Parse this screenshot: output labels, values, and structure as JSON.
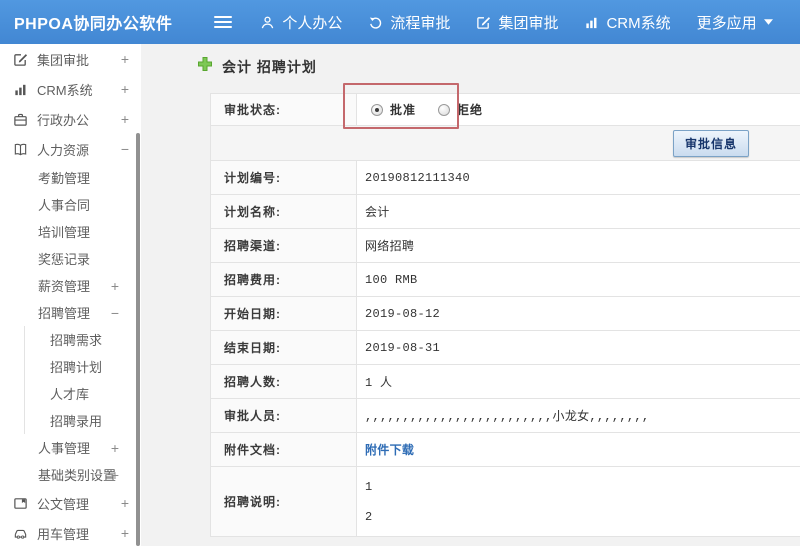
{
  "colors": {
    "header_blue": "#4a90dc",
    "annotation_red": "#c4686c",
    "link_blue": "#2e6cb5",
    "plus_green": "#76c043"
  },
  "header": {
    "brand": "PHPOA协同办公软件",
    "nav": [
      {
        "name": "personal-office",
        "label": "个人办公",
        "icon": "person-icon"
      },
      {
        "name": "workflow-approval",
        "label": "流程审批",
        "icon": "cycle-icon"
      },
      {
        "name": "group-approval",
        "label": "集团审批",
        "icon": "edit-square-icon"
      },
      {
        "name": "crm-system",
        "label": "CRM系统",
        "icon": "bar-chart-icon"
      },
      {
        "name": "more-apps",
        "label": "更多应用",
        "caret": true
      }
    ]
  },
  "sidebar": {
    "items": [
      {
        "name": "group-approval",
        "label": "集团审批",
        "icon": "edit-square-icon",
        "expander": "+",
        "level": 0
      },
      {
        "name": "crm-system",
        "label": "CRM系统",
        "icon": "bar-chart-icon",
        "expander": "+",
        "level": 0
      },
      {
        "name": "admin-office",
        "label": "行政办公",
        "icon": "briefcase-icon",
        "expander": "+",
        "level": 0
      },
      {
        "name": "human-resources",
        "label": "人力资源",
        "icon": "book-icon",
        "expander": "−",
        "level": 0
      },
      {
        "name": "attendance-mgmt",
        "label": "考勤管理",
        "level": 1
      },
      {
        "name": "personnel-contract",
        "label": "人事合同",
        "level": 1
      },
      {
        "name": "training-mgmt",
        "label": "培训管理",
        "level": 1
      },
      {
        "name": "reward-punishment",
        "label": "奖惩记录",
        "level": 1
      },
      {
        "name": "salary-mgmt",
        "label": "薪资管理",
        "expander": "+",
        "level": 1
      },
      {
        "name": "recruitment-mgmt",
        "label": "招聘管理",
        "expander": "−",
        "level": 1
      },
      {
        "name": "recruitment-needs",
        "label": "招聘需求",
        "level": 2
      },
      {
        "name": "recruitment-plan",
        "label": "招聘计划",
        "level": 2
      },
      {
        "name": "talent-pool",
        "label": "人才库",
        "level": 2
      },
      {
        "name": "recruitment-hiring",
        "label": "招聘录用",
        "level": 2
      },
      {
        "name": "personnel-mgmt",
        "label": "人事管理",
        "expander": "+",
        "level": 1
      },
      {
        "name": "basic-category-settings",
        "label": "基础类别设置",
        "expander": "+",
        "level": 1
      },
      {
        "name": "document-mgmt",
        "label": "公文管理",
        "icon": "document-icon",
        "expander": "+",
        "level": 0
      },
      {
        "name": "vehicle-mgmt",
        "label": "用车管理",
        "icon": "car-icon",
        "expander": "+",
        "level": 0
      }
    ]
  },
  "main": {
    "title": "会计 招聘计划",
    "approval": {
      "label": "审批状态:",
      "options": [
        {
          "label": "批准",
          "selected": true
        },
        {
          "label": "拒绝",
          "selected": false
        }
      ]
    },
    "approve_button_label": "审批信息",
    "rows": [
      {
        "name": "plan-number",
        "type": "text",
        "label": "计划编号:",
        "value": "20190812111340"
      },
      {
        "name": "plan-name",
        "type": "text",
        "label": "计划名称:",
        "value": "会计"
      },
      {
        "name": "recruitment-channel",
        "type": "text",
        "label": "招聘渠道:",
        "value": "网络招聘"
      },
      {
        "name": "recruitment-cost",
        "type": "text",
        "label": "招聘费用:",
        "value": "100 RMB"
      },
      {
        "name": "start-date",
        "type": "text",
        "label": "开始日期:",
        "value": "2019-08-12"
      },
      {
        "name": "end-date",
        "type": "text",
        "label": "结束日期:",
        "value": "2019-08-31"
      },
      {
        "name": "recruitment-headcount",
        "type": "text",
        "label": "招聘人数:",
        "value": "1 人"
      },
      {
        "name": "approval-personnel",
        "type": "text",
        "label": "审批人员:",
        "value": ",,,,,,,,,,,,,,,,,,,,,,,,,小龙女,,,,,,,,"
      },
      {
        "name": "attachment-document",
        "type": "link",
        "label": "附件文档:",
        "value": "附件下载"
      },
      {
        "name": "recruitment-description",
        "type": "multiline",
        "label": "招聘说明:",
        "lines": [
          "1",
          "2"
        ]
      }
    ]
  }
}
